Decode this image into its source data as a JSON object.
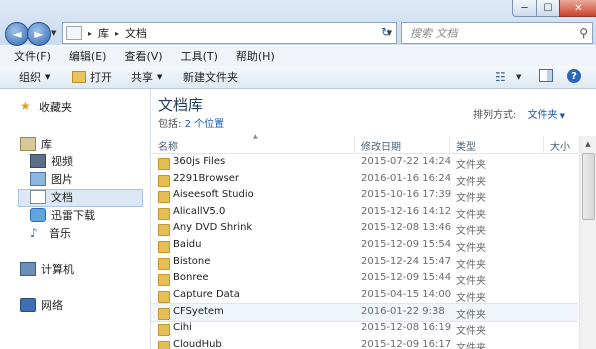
{
  "window": {
    "controls": {
      "min": "─",
      "max": "☐",
      "close": "✕"
    }
  },
  "address": {
    "crumbs": [
      "库",
      "文档"
    ],
    "separator": "▸",
    "search_placeholder": "搜索 文档"
  },
  "menubar": [
    "文件(F)",
    "编辑(E)",
    "查看(V)",
    "工具(T)",
    "帮助(H)"
  ],
  "toolbar": {
    "organize": "组织",
    "open": "打开",
    "share": "共享",
    "new_folder": "新建文件夹"
  },
  "nav": {
    "favorites": "收藏夹",
    "libraries": "库",
    "videos": "视频",
    "pictures": "图片",
    "documents": "文档",
    "xunlei": "迅雷下载",
    "music": "音乐",
    "computer": "计算机",
    "network": "网络"
  },
  "library": {
    "title": "文档库",
    "includes_label": "包括:",
    "includes_link": "2 个位置",
    "arrange_label": "排列方式:",
    "arrange_value": "文件夹"
  },
  "columns": {
    "name": "名称",
    "date": "修改日期",
    "type": "类型",
    "size": "大小"
  },
  "files": [
    {
      "name": "360js Files",
      "date": "2015-07-22 14:24",
      "type": "文件夹"
    },
    {
      "name": "2291Browser",
      "date": "2016-01-16 16:24",
      "type": "文件夹"
    },
    {
      "name": "Aiseesoft Studio",
      "date": "2015-10-16 17:39",
      "type": "文件夹"
    },
    {
      "name": "AlicallV5.0",
      "date": "2015-12-16 14:12",
      "type": "文件夹"
    },
    {
      "name": "Any DVD Shrink",
      "date": "2015-12-08 13:46",
      "type": "文件夹"
    },
    {
      "name": "Baidu",
      "date": "2015-12-09 15:54",
      "type": "文件夹"
    },
    {
      "name": "Bistone",
      "date": "2015-12-24 15:47",
      "type": "文件夹"
    },
    {
      "name": "Bonree",
      "date": "2015-12-09 15:44",
      "type": "文件夹"
    },
    {
      "name": "Capture Data",
      "date": "2015-04-15 14:00",
      "type": "文件夹"
    },
    {
      "name": "CFSyetem",
      "date": "2016-01-22 9:38",
      "type": "文件夹"
    },
    {
      "name": "Cihi",
      "date": "2015-12-08 16:19",
      "type": "文件夹"
    },
    {
      "name": "CloudHub",
      "date": "2015-12-09 16:17",
      "type": "文件夹"
    }
  ],
  "highlighted_row": 9
}
